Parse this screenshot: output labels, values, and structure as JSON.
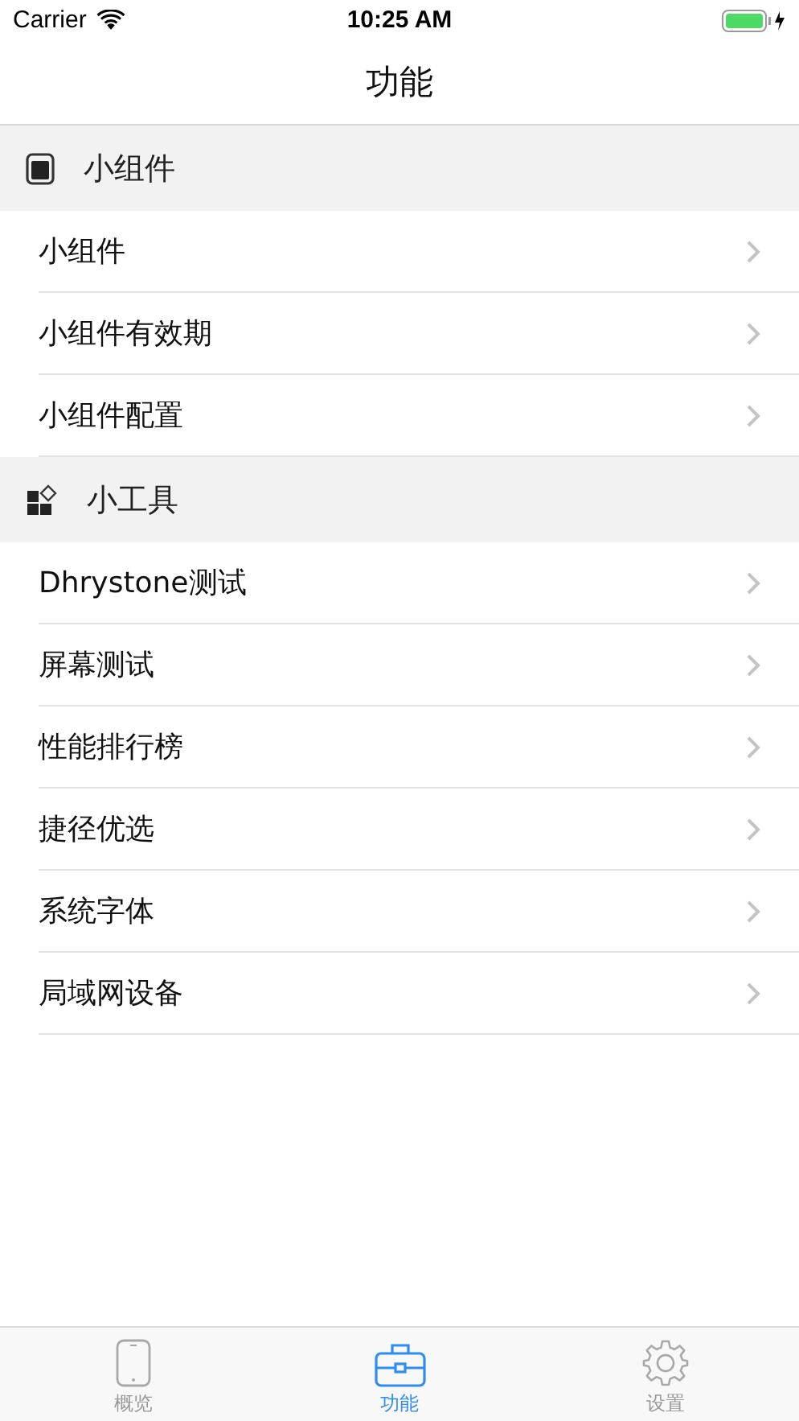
{
  "status_bar": {
    "carrier": "Carrier",
    "time": "10:25 AM"
  },
  "nav": {
    "title": "功能"
  },
  "sections": [
    {
      "title": "小组件",
      "items": [
        "小组件",
        "小组件有效期",
        "小组件配置"
      ]
    },
    {
      "title": "小工具",
      "items": [
        "Dhrystone测试",
        "屏幕测试",
        "性能排行榜",
        "捷径优选",
        "系统字体",
        "局域网设备"
      ]
    }
  ],
  "tabs": [
    {
      "label": "概览",
      "selected": false
    },
    {
      "label": "功能",
      "selected": true
    },
    {
      "label": "设置",
      "selected": false
    }
  ]
}
